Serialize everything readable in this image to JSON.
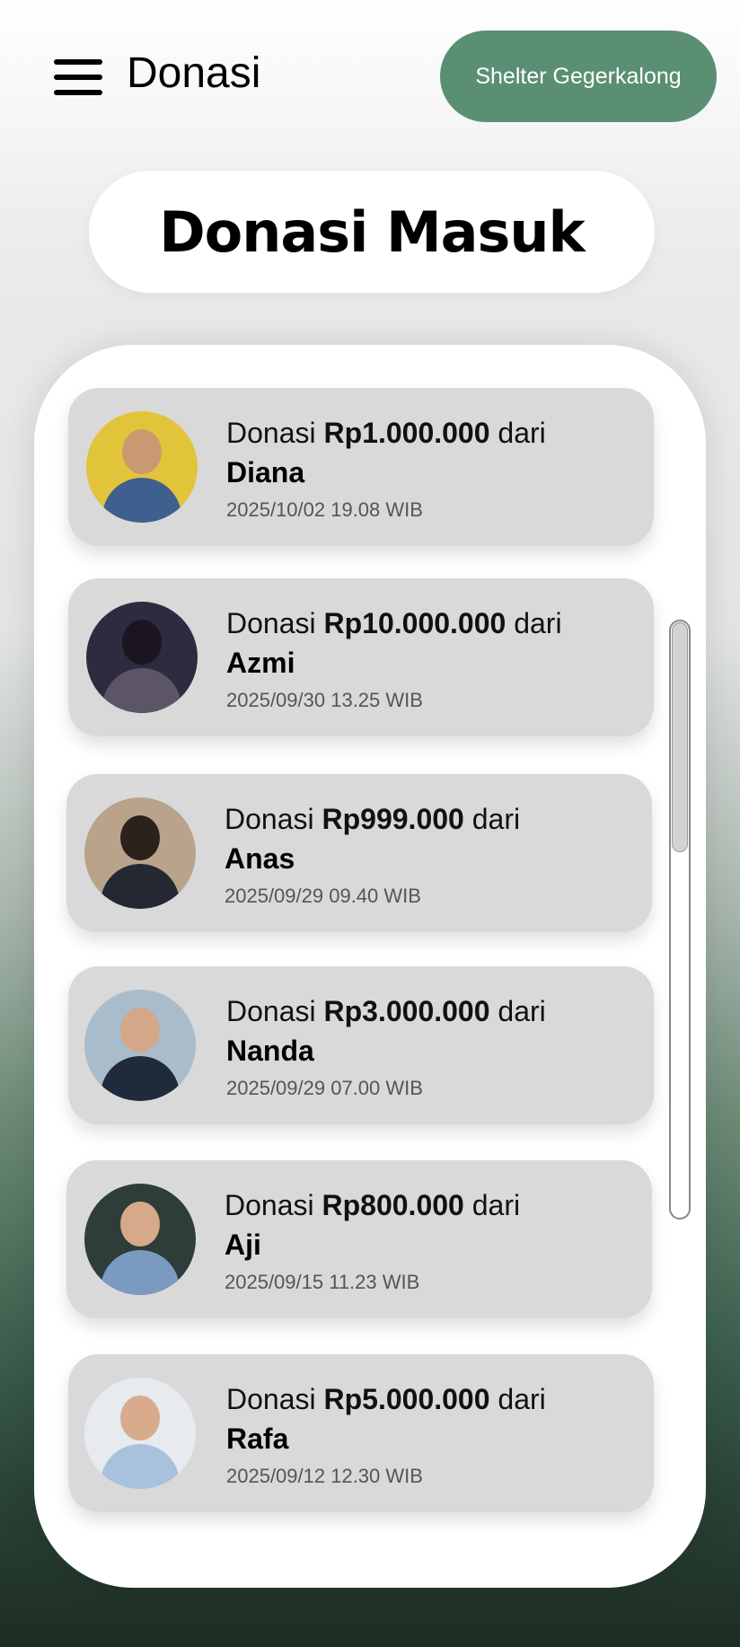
{
  "header": {
    "title": "Donasi",
    "shelter_button": "Shelter Gegerkalong"
  },
  "page_title": "Donasi Masuk",
  "donations": [
    {
      "prefix": "Donasi",
      "amount": "Rp1.000.000",
      "suffix": "dari",
      "donor": "Diana",
      "date": "2025/10/02 19.08 WIB",
      "avatar_bg": "#e2c43a",
      "avatar_head": "#c99a72",
      "avatar_body": "#3f5f8e"
    },
    {
      "prefix": "Donasi",
      "amount": "Rp10.000.000",
      "suffix": "dari",
      "donor": "Azmi",
      "date": "2025/09/30 13.25 WIB",
      "avatar_bg": "#2e2a3f",
      "avatar_head": "#1a1520",
      "avatar_body": "#5b5566"
    },
    {
      "prefix": "Donasi",
      "amount": "Rp999.000",
      "suffix": "dari",
      "donor": "Anas",
      "date": "2025/09/29 09.40 WIB",
      "avatar_bg": "#b9a38a",
      "avatar_head": "#2b221c",
      "avatar_body": "#232833"
    },
    {
      "prefix": "Donasi",
      "amount": "Rp3.000.000",
      "suffix": "dari",
      "donor": "Nanda",
      "date": "2025/09/29 07.00 WIB",
      "avatar_bg": "#a9bccb",
      "avatar_head": "#d3a888",
      "avatar_body": "#1f2a3d"
    },
    {
      "prefix": "Donasi",
      "amount": "Rp800.000",
      "suffix": "dari",
      "donor": "Aji",
      "date": "2025/09/15 11.23 WIB",
      "avatar_bg": "#2e3d3a",
      "avatar_head": "#d6a98a",
      "avatar_body": "#7a9ac2"
    },
    {
      "prefix": "Donasi",
      "amount": "Rp5.000.000",
      "suffix": "dari",
      "donor": "Rafa",
      "date": "2025/09/12 12.30 WIB",
      "avatar_bg": "#e7eaee",
      "avatar_head": "#d8ab8c",
      "avatar_body": "#a8c1dd"
    }
  ]
}
